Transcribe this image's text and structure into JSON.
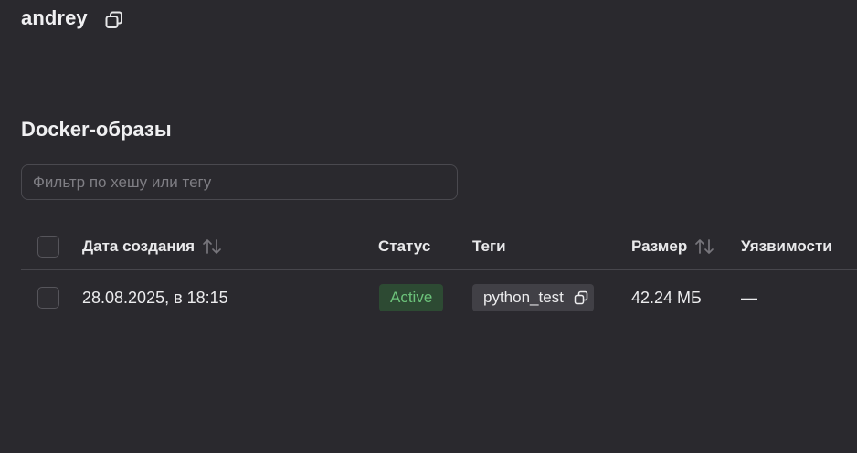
{
  "header": {
    "repository_name": "andrey",
    "copy_icon": "copy-icon"
  },
  "section": {
    "title": "Docker-образы"
  },
  "filter": {
    "placeholder": "Фильтр по хешу или тегу",
    "value": ""
  },
  "table": {
    "columns": {
      "created": "Дата создания",
      "status": "Статус",
      "tags": "Теги",
      "size": "Размер",
      "vulnerabilities": "Уязвимости"
    },
    "sortable_icon": "sort-arrows-icon",
    "rows": [
      {
        "created": "28.08.2025, в 18:15",
        "status": "Active",
        "tag": "python_test",
        "size": "42.24 МБ",
        "vulnerabilities": "—"
      }
    ]
  },
  "colors": {
    "background": "#2a292e",
    "status_active_text": "#6cc27a",
    "status_active_bg": "#2d4a33",
    "tag_bg": "#414046"
  }
}
